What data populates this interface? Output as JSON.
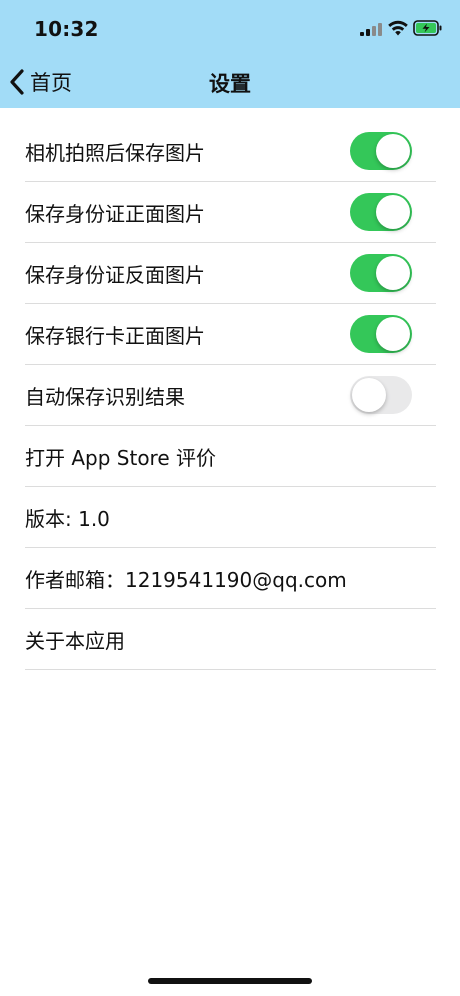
{
  "status_bar": {
    "time": "10:32"
  },
  "nav": {
    "back_label": "首页",
    "title": "设置"
  },
  "colors": {
    "nav_background": "#a2dcf7",
    "toggle_on": "#34c759",
    "toggle_off": "#e9e9ea",
    "battery_charging": "#34c759"
  },
  "settings": [
    {
      "label": "相机拍照后保存图片",
      "toggle": true
    },
    {
      "label": "保存身份证正面图片",
      "toggle": true
    },
    {
      "label": "保存身份证反面图片",
      "toggle": true
    },
    {
      "label": "保存银行卡正面图片",
      "toggle": true
    },
    {
      "label": "自动保存识别结果",
      "toggle": false
    },
    {
      "label": "打开 App Store 评价"
    },
    {
      "label": "版本: 1.0"
    },
    {
      "label": "作者邮箱：1219541190@qq.com"
    },
    {
      "label": "关于本应用"
    }
  ]
}
